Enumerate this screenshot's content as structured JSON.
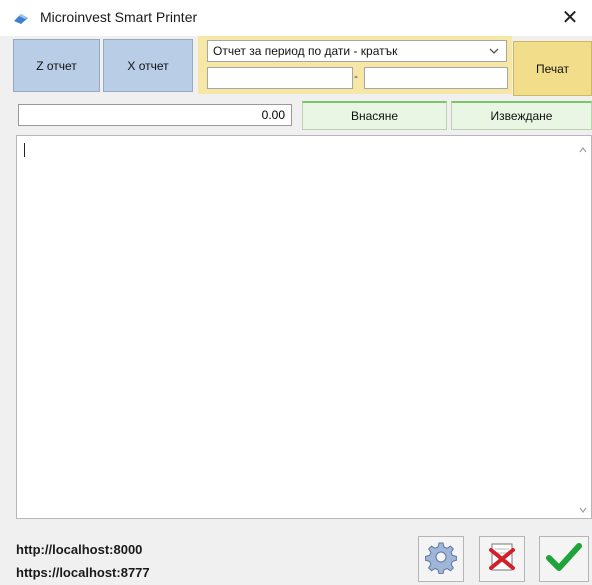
{
  "window": {
    "title": "Microinvest Smart Printer",
    "close_symbol": "✕"
  },
  "toolbar": {
    "z_report_label": "Z отчет",
    "x_report_label": "X отчет",
    "period_select": {
      "selected": "Отчет за период по дати - кратък"
    },
    "date_from": {
      "value": ""
    },
    "date_to": {
      "value": ""
    },
    "date_separator": "-",
    "print_label": "Печат"
  },
  "cash": {
    "amount": "0.00",
    "deposit_label": "Внасяне",
    "withdraw_label": "Извеждане"
  },
  "output": {
    "text": ""
  },
  "footer": {
    "http_url": "http://localhost:8000",
    "https_url": "https://localhost:8777"
  },
  "icons": {
    "app": "printer-icon",
    "settings": "gear-icon",
    "cancel": "cancel-document-icon",
    "ok": "checkmark-icon"
  },
  "colors": {
    "report_button": "#b9cde6",
    "period_panel": "#f7e7a6",
    "print_button": "#f2de8a",
    "cash_button": "#e9f6e3",
    "ok_green": "#1fa33a",
    "cancel_red": "#d0202a"
  }
}
